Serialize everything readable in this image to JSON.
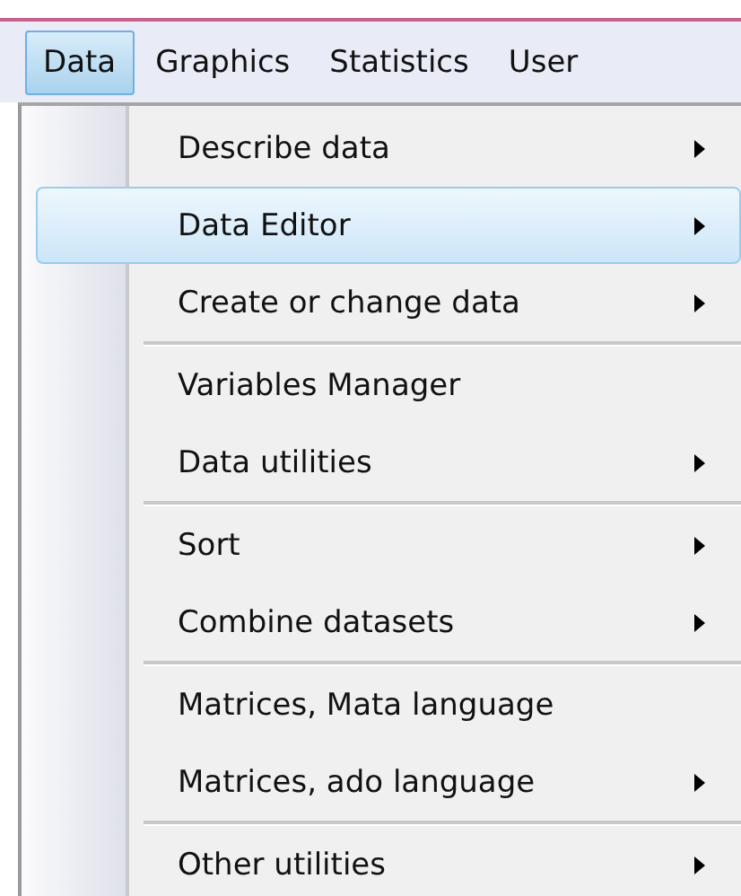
{
  "menubar": [
    {
      "label": "Data",
      "selected": true
    },
    {
      "label": "Graphics",
      "selected": false
    },
    {
      "label": "Statistics",
      "selected": false
    },
    {
      "label": "User",
      "selected": false
    }
  ],
  "menu": {
    "groups": [
      {
        "items": [
          {
            "label": "Describe data",
            "submenu": true,
            "selected": false
          },
          {
            "label": "Data Editor",
            "submenu": true,
            "selected": true
          },
          {
            "label": "Create or change data",
            "submenu": true,
            "selected": false
          }
        ]
      },
      {
        "items": [
          {
            "label": "Variables Manager",
            "submenu": false,
            "selected": false
          },
          {
            "label": "Data utilities",
            "submenu": true,
            "selected": false
          }
        ]
      },
      {
        "items": [
          {
            "label": "Sort",
            "submenu": true,
            "selected": false
          },
          {
            "label": "Combine datasets",
            "submenu": true,
            "selected": false
          }
        ]
      },
      {
        "items": [
          {
            "label": "Matrices, Mata language",
            "submenu": false,
            "selected": false
          },
          {
            "label": "Matrices, ado language",
            "submenu": true,
            "selected": false
          }
        ]
      },
      {
        "items": [
          {
            "label": "Other utilities",
            "submenu": true,
            "selected": false
          }
        ]
      }
    ]
  }
}
